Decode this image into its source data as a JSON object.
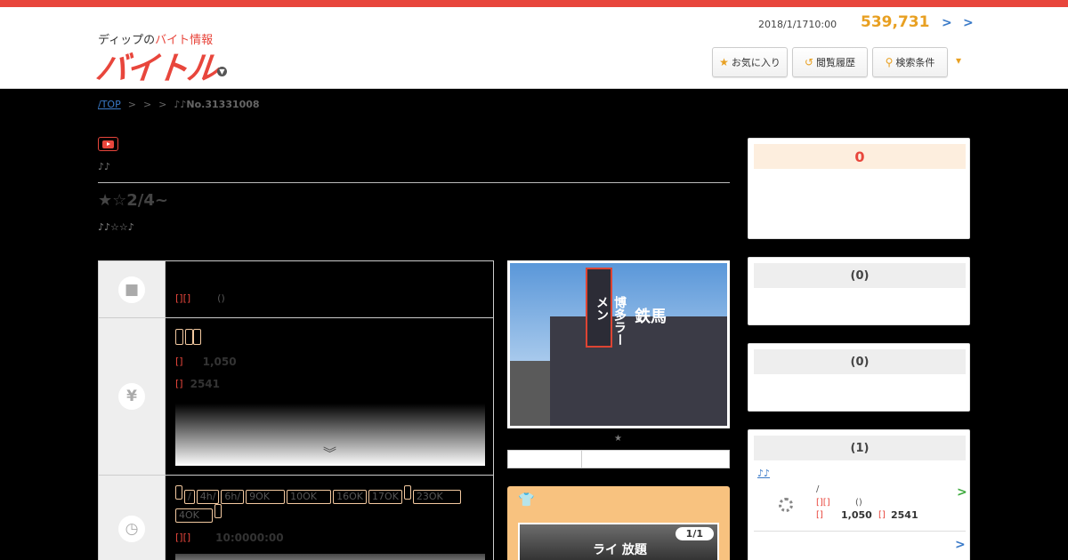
{
  "header": {
    "logo_small_prefix": "ディップの",
    "logo_small_highlight": "バイト情報",
    "logo_main": "バイトル",
    "date": "2018/1/1710:00",
    "job_count": "539,731",
    "chevron": ">",
    "buttons": [
      {
        "icon": "star-icon",
        "label": "お気に入り"
      },
      {
        "icon": "history-icon",
        "label": "閲覧履歴"
      },
      {
        "icon": "search-icon",
        "label": "検索条件"
      }
    ],
    "more": "▾"
  },
  "breadcrumb": {
    "top": "/TOP",
    "sep1": ">",
    "sep2": ">",
    "sep3": ">",
    "current": "♪♪No.31331008"
  },
  "job": {
    "notes1": "♪♪",
    "catch": "★☆2/4~",
    "notes2": "♪♪☆☆♪",
    "rows": {
      "work": {
        "icon": "briefcase-icon",
        "label": "[][]",
        "value": "()"
      },
      "pay": {
        "icon": "yen-icon",
        "tags": [
          "",
          "",
          ""
        ],
        "line1_label": "[]",
        "line1_value": "1,050",
        "line2_label": "[]",
        "line2_value": "2541",
        "toggle": "︾"
      },
      "time": {
        "icon": "clock-icon",
        "tags": [
          "",
          "/",
          "4h/",
          "6h/",
          "9OK",
          "10OK",
          "16OK",
          "17OK",
          "",
          "23OK",
          "4OK",
          ""
        ],
        "line_label": "[][]",
        "line_value": "10:0000:00"
      }
    }
  },
  "photo": {
    "sign": "博多ラーメン",
    "store": "鉄馬",
    "star": "★"
  },
  "uniform": {
    "icon": "shirt-icon",
    "pic_text": "ライ 放題",
    "counter": "1/1"
  },
  "sidebar": {
    "box1": {
      "heading": "0"
    },
    "box2": {
      "heading": "(0)"
    },
    "box3": {
      "heading": "(0)"
    },
    "box4": {
      "heading": "(1)",
      "link": "♪♪",
      "slash": "/",
      "label1": "[][]",
      "value1": "()",
      "label2": "[]",
      "value2": "1,050",
      "label3": "[]",
      "value3": "2541",
      "chev": ">"
    }
  },
  "colors": {
    "brand": "#e8463c",
    "accent": "#e8a022",
    "link": "#3a7ac8"
  }
}
